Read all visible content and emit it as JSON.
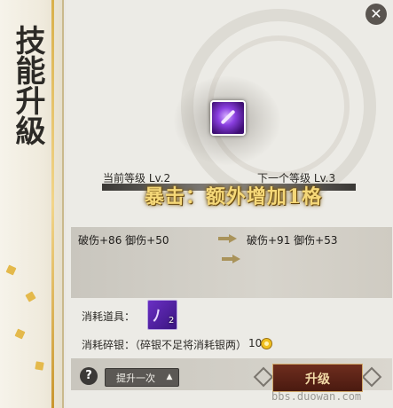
{
  "panel": {
    "side_title": "技能升級",
    "close_icon": "close-icon"
  },
  "skill": {
    "icon": "purple-skill-icon",
    "current_level_label": "当前等级 Lv.2",
    "next_level_label": "下一个等级 Lv.3",
    "upgrade_effect": "暴击：额外增加1格"
  },
  "stats": {
    "current": "破伤+86 御伤+50",
    "next": "破伤+91 御伤+53"
  },
  "cost": {
    "item_label": "消耗道具：",
    "item_icon": "purple-rune-icon",
    "item_count": "2",
    "shard_label": "消耗碎银：（碎银不足将消耗银两）",
    "shard_amount": "10",
    "shard_icon": "coin-icon"
  },
  "footer": {
    "help_label": "?",
    "dropdown_label": "提升一次",
    "dropdown_caret": "▲",
    "upgrade_label": "升级"
  },
  "watermark": "bbs.duowan.com",
  "colors": {
    "accent_gold": "#d9b04a",
    "banner_text": "#f5d878",
    "upgrade_button": "#5a2418",
    "skill_purple": "#8a3fe0"
  }
}
